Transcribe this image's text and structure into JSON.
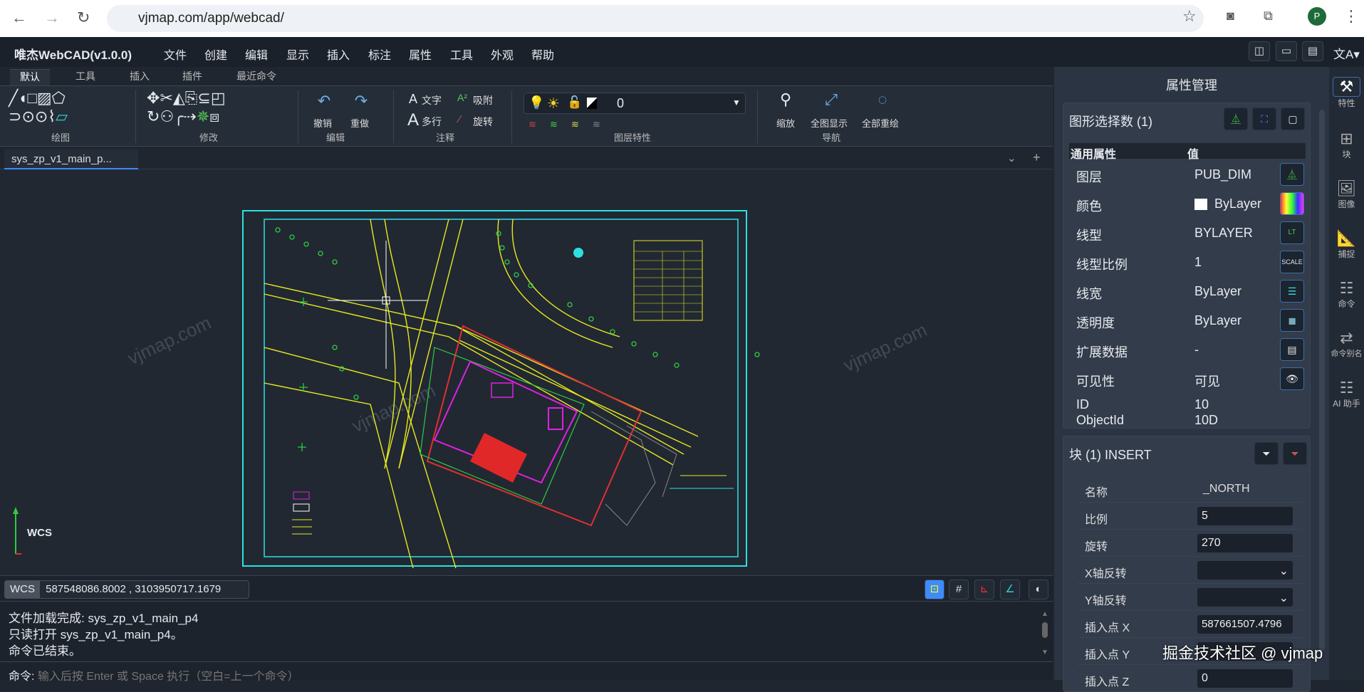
{
  "browser": {
    "url": "vjmap.com/app/webcad/",
    "profile": "P"
  },
  "app": {
    "name": "唯杰WebCAD(v1.0.0)",
    "menu": [
      "文件",
      "创建",
      "编辑",
      "显示",
      "插入",
      "标注",
      "属性",
      "工具",
      "外观",
      "帮助"
    ]
  },
  "ribbon": {
    "tabs": [
      "默认",
      "工具",
      "插入",
      "插件",
      "最近命令"
    ],
    "groups": {
      "draw": "绘图",
      "modify": "修改",
      "edit": "编辑",
      "annotate": "注释",
      "layer": "图层特性",
      "nav": "导航"
    },
    "buttons": {
      "undo": "撤销",
      "redo": "重做",
      "text": "文字",
      "mtext": "多行",
      "snap": "吸附",
      "rotate": "旋转",
      "zoom": "缩放",
      "zoom_extents": "全图显示",
      "regen": "全部重绘"
    },
    "layer_value": "0"
  },
  "doc_tab": "sys_zp_v1_main_p...",
  "canvas": {
    "watermark": "vjmap.com",
    "ucs_label": "WCS"
  },
  "coords": {
    "system": "WCS",
    "value": "587548086.8002 , 3103950717.1679"
  },
  "output": [
    "文件加载完成: sys_zp_v1_main_p4",
    "只读打开 sys_zp_v1_main_p4。",
    "命令已结束。"
  ],
  "command": {
    "label": "命令:",
    "placeholder": "输入后按 Enter 或 Space 执行（空白=上一个命令）"
  },
  "panel": {
    "title": "属性管理",
    "selection": "图形选择数 (1)",
    "col_prop": "通用属性",
    "col_val": "值",
    "rows": [
      {
        "label": "图层",
        "value": "PUB_DIM"
      },
      {
        "label": "颜色",
        "value": "ByLayer"
      },
      {
        "label": "线型",
        "value": "BYLAYER"
      },
      {
        "label": "线型比例",
        "value": "1"
      },
      {
        "label": "线宽",
        "value": "ByLayer"
      },
      {
        "label": "透明度",
        "value": "ByLayer"
      },
      {
        "label": "扩展数据",
        "value": "-"
      },
      {
        "label": "可见性",
        "value": "可见"
      },
      {
        "label": "ID",
        "value": "10"
      },
      {
        "label": "ObjectId",
        "value": "10D"
      }
    ],
    "block_title": "块 (1) INSERT",
    "block_rows": [
      {
        "label": "名称",
        "value": "_NORTH"
      },
      {
        "label": "比例",
        "value": "5"
      },
      {
        "label": "旋转",
        "value": "270"
      },
      {
        "label": "X轴反转",
        "value": ""
      },
      {
        "label": "Y轴反转",
        "value": ""
      },
      {
        "label": "插入点 X",
        "value": "587661507.4796"
      },
      {
        "label": "插入点 Y",
        "value": ""
      },
      {
        "label": "插入点 Z",
        "value": "0"
      }
    ]
  },
  "sidebar": [
    "特性",
    "块",
    "图像",
    "捕捉",
    "命令",
    "命令别名",
    "AI 助手"
  ],
  "overlay_watermark": "掘金技术社区 @ vjmap"
}
